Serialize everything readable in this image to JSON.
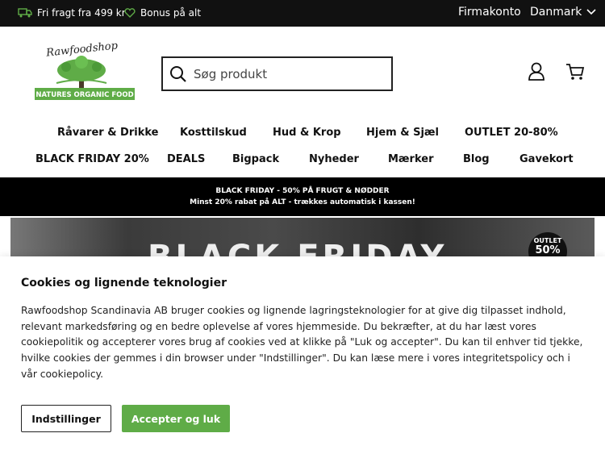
{
  "topbar": {
    "usp_shipping": "Fri fragt fra 499 kr",
    "usp_bonus": "Bonus på alt",
    "company_account": "Firmakonto",
    "country": "Danmark"
  },
  "header": {
    "logo_text_top": "Rawfoodshop",
    "logo_text_ribbon": "NATURES ORGANIC FOOD",
    "search_placeholder": "Søg produkt"
  },
  "nav": {
    "row1": [
      "Råvarer & Drikke",
      "Kosttilskud",
      "Hud & Krop",
      "Hjem & Sjæl",
      "OUTLET 20-80%"
    ],
    "row2": [
      "BLACK FRIDAY 20%",
      "DEALS",
      "Bigpack",
      "Nyheder",
      "Mærker",
      "Blog",
      "Gavekort"
    ]
  },
  "promo": {
    "line1": "BLACK FRIDAY - 50% PÅ FRUGT & NØDDER",
    "line2": "Minst 20% rabat på ALT - trækkes automatisk i kassen!"
  },
  "hero": {
    "headline": "BLACK FRIDAY",
    "badge_top": "OUTLET",
    "badge_value": "50%"
  },
  "cookie": {
    "title": "Cookies og lignende teknologier",
    "body": "Rawfoodshop Scandinavia AB bruger cookies og lignende lagringsteknologier for at give dig tilpasset indhold, relevant markedsføring og en bedre oplevelse af vores hjemmeside. Du bekræfter, at du har læst vores cookiepolitik og accepterer vores brug af cookies ved at klikke på \"Luk og accepter\". Du kan til enhver tid tjekke, hvilke cookies der gemmes i din browser under \"Indstillinger\". Du kan læse mere i vores integritetspolicy och i vår cookiepolicy.",
    "settings_label": "Indstillinger",
    "accept_label": "Accepter og luk"
  },
  "colors": {
    "topbar_bg": "#111111",
    "accent_green": "#5fac47",
    "promo_bg": "#000000"
  },
  "icons": [
    "truck-icon",
    "heart-icon",
    "chevron-down-icon",
    "search-icon",
    "user-icon",
    "cart-icon"
  ]
}
